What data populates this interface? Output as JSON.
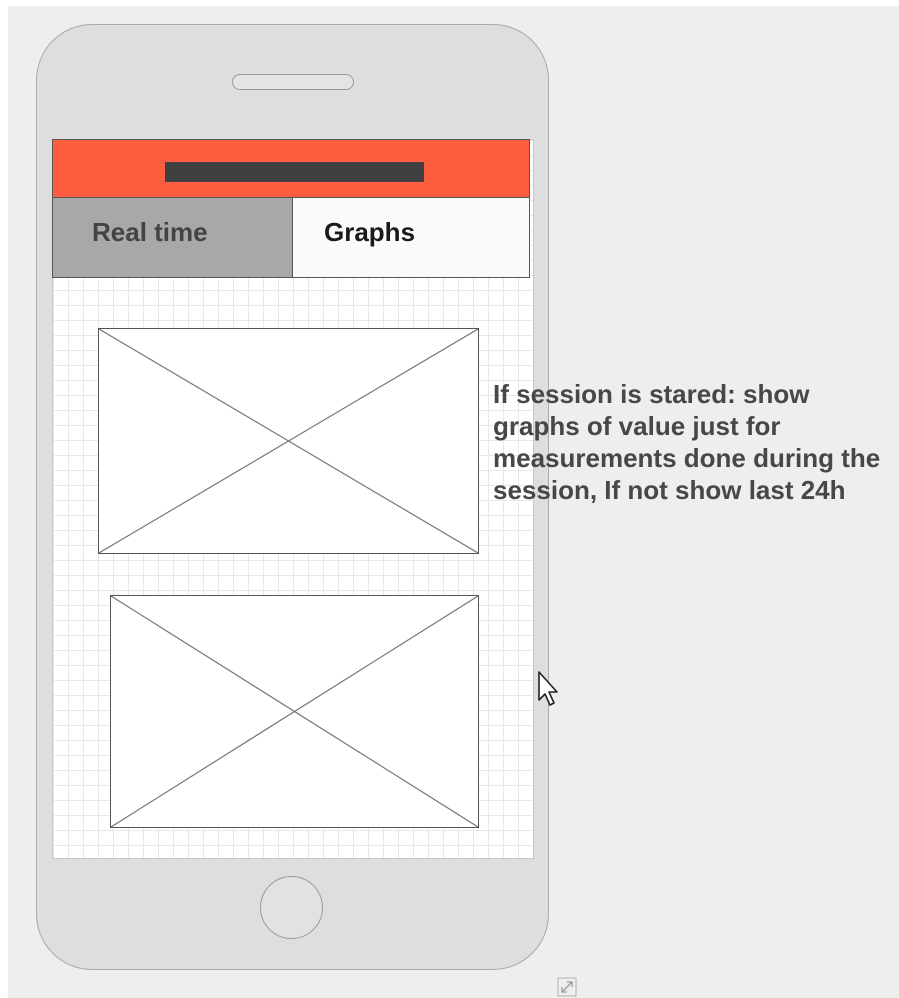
{
  "mockup": {
    "tabs": [
      {
        "label": "Real time",
        "state": "inactive"
      },
      {
        "label": "Graphs",
        "state": "active"
      }
    ],
    "header": {
      "color": "#fd5e40",
      "title_placeholder": "dark-bar"
    },
    "graph_placeholders": [
      {
        "icon": "image-placeholder-icon"
      },
      {
        "icon": "image-placeholder-icon"
      }
    ],
    "annotation": "If session is stared: show graphs of value just for measurements done during the session, If not show last 24h"
  },
  "icons": {
    "cursor": "mouse-pointer-icon",
    "resize": "resize-handle-icon"
  }
}
